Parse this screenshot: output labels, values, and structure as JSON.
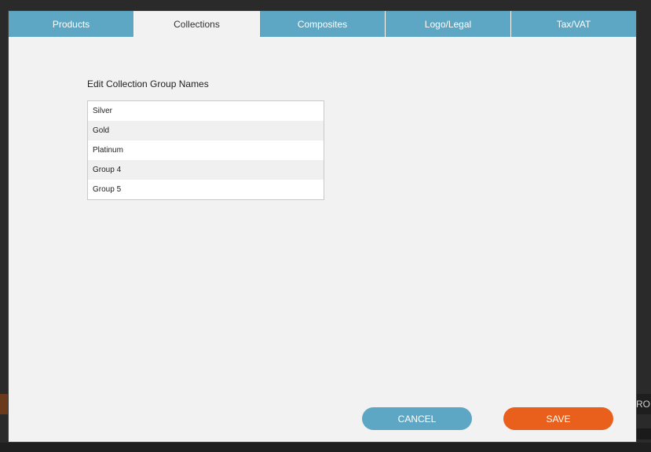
{
  "tabs": [
    {
      "label": "Products",
      "active": false
    },
    {
      "label": "Collections",
      "active": true
    },
    {
      "label": "Composites",
      "active": false
    },
    {
      "label": "Logo/Legal",
      "active": false
    },
    {
      "label": "Tax/VAT",
      "active": false
    }
  ],
  "collections": {
    "title": "Edit Collection Group Names",
    "groups": [
      "Silver",
      "Gold",
      "Platinum",
      "Group 4",
      "Group 5"
    ]
  },
  "buttons": {
    "cancel_label": "CANCEL",
    "save_label": "SAVE"
  },
  "background": {
    "right_strip_text": "RO"
  },
  "colors": {
    "tab_blue": "#5ea7c4",
    "save_orange": "#e8601c",
    "dialog_bg": "#f2f2f2"
  }
}
